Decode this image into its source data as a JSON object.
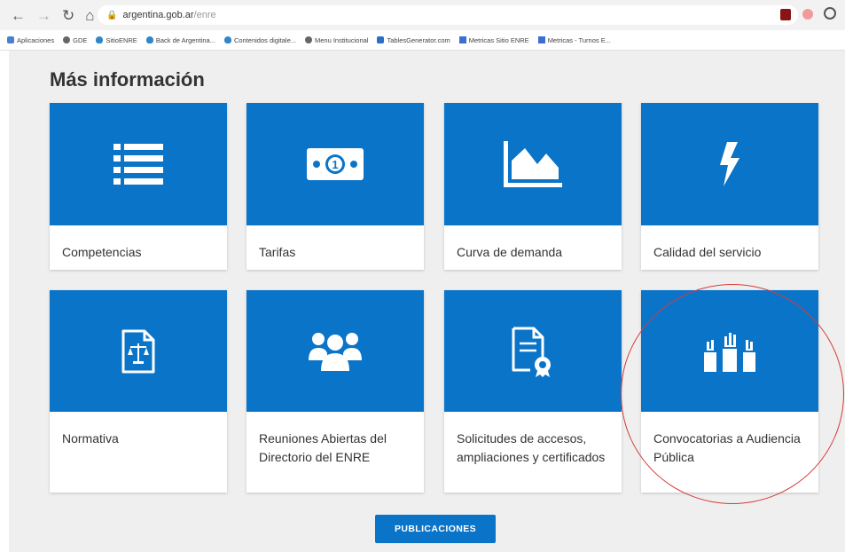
{
  "browser": {
    "url_host": "argentina.gob.ar",
    "url_path": "/enre",
    "bookmarks": [
      {
        "label": "Aplicaciones",
        "icon": "apps-grid-icon",
        "color": "#4a7fd4"
      },
      {
        "label": "GDE",
        "icon": "globe-icon",
        "color": "#666666"
      },
      {
        "label": "SitioENRE",
        "icon": "flame-icon",
        "color": "#2f87c9"
      },
      {
        "label": "Back de Argentina...",
        "icon": "flame-icon",
        "color": "#2f87c9"
      },
      {
        "label": "Contenidos digitale...",
        "icon": "flame-icon",
        "color": "#2f87c9"
      },
      {
        "label": "Menu Institucional",
        "icon": "globe-icon",
        "color": "#666666"
      },
      {
        "label": "TablesGenerator.com",
        "icon": "table-icon",
        "color": "#2b6fc2"
      },
      {
        "label": "Metricas Sitio ENRE",
        "icon": "analytics-icon",
        "color": "#3b6ed1"
      },
      {
        "label": "Metricas - Turnos E...",
        "icon": "analytics-icon",
        "color": "#3b6ed1"
      }
    ]
  },
  "section": {
    "title": "Más información"
  },
  "cards": [
    {
      "label": "Competencias",
      "icon": "list-icon"
    },
    {
      "label": "Tarifas",
      "icon": "banknote-icon"
    },
    {
      "label": "Curva de demanda",
      "icon": "area-chart-icon"
    },
    {
      "label": "Calidad del servicio",
      "icon": "lightning-icon"
    },
    {
      "label": "Normativa",
      "icon": "legal-document-icon"
    },
    {
      "label": "Reuniones Abiertas del Directorio del ENRE",
      "icon": "people-group-icon"
    },
    {
      "label": "Solicitudes de accesos, ampliaciones y certificados",
      "icon": "certificate-document-icon"
    },
    {
      "label": "Convocatorias a Audiencia Pública",
      "icon": "raised-hands-icon"
    }
  ],
  "publicaciones_button": "PUBLICACIONES",
  "colors": {
    "accent": "#0a74c9",
    "highlight": "#d63a3a",
    "page_bg": "#efefef"
  }
}
